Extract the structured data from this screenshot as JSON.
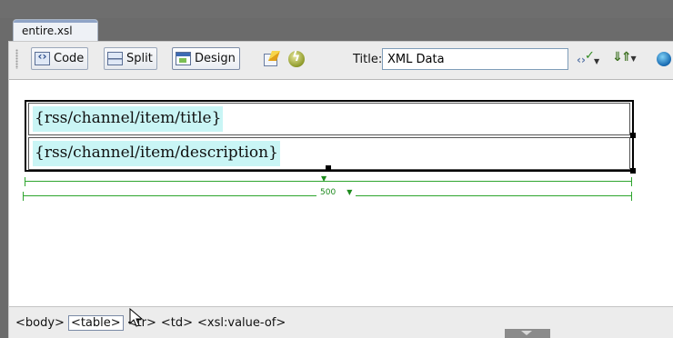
{
  "document": {
    "tab_name": "entire.xsl"
  },
  "toolbar": {
    "code_label": "Code",
    "split_label": "Split",
    "design_label": "Design",
    "title_label": "Title:",
    "title_value": "XML Data",
    "icons": [
      "code-view-icon",
      "split-view-icon",
      "design-view-icon",
      "live-view-icon",
      "live-data-icon",
      "validate-icon",
      "sort-icon",
      "browser-preview-icon"
    ]
  },
  "design_view": {
    "rows": [
      {
        "value": "{rss/channel/item/title}"
      },
      {
        "value": "{rss/channel/item/description}"
      }
    ],
    "table_width": "500"
  },
  "tag_selector": {
    "tags": [
      "<body>",
      "<table>",
      "<tr>",
      "<td>",
      "<xsl:value-of>"
    ],
    "selected_index": 1
  },
  "colors": {
    "xsl_highlight": "#c9f5f5",
    "width_indicator": "#2ea52e",
    "panel_bg": "#ececec"
  }
}
